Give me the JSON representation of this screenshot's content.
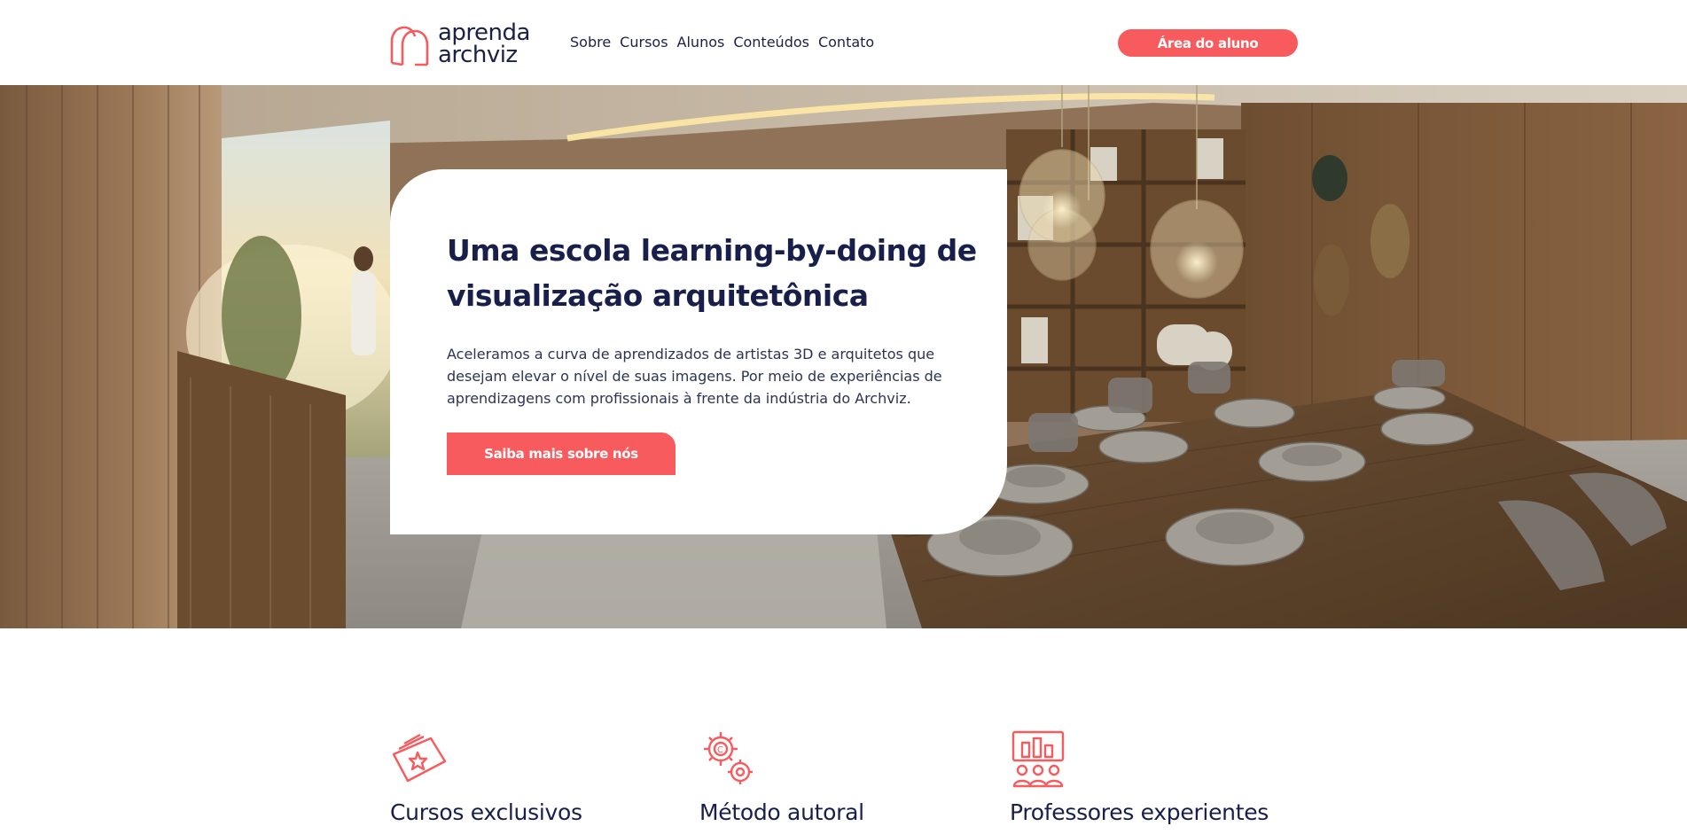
{
  "header": {
    "logo": {
      "line1": "aprenda",
      "line2": "archviz",
      "icon": "logo-arch-icon"
    },
    "nav": [
      {
        "label": "Sobre"
      },
      {
        "label": "Cursos"
      },
      {
        "label": "Alunos"
      },
      {
        "label": "Conteúdos"
      },
      {
        "label": "Contato"
      }
    ],
    "cta_label": "Área do aluno"
  },
  "hero": {
    "title": "Uma escola learning-by-doing de visualização arquitetônica",
    "description": "Aceleramos a curva de aprendizados de artistas 3D e arquitetos que desejam elevar o nível de suas imagens. Por meio de experiências de aprendizagens com profissionais à frente da indústria do Archviz.",
    "button_label": "Saiba mais sobre nós",
    "image": "dining-room-render"
  },
  "features": [
    {
      "title": "Cursos exclusivos",
      "icon": "tickets-icon"
    },
    {
      "title": "Método autoral",
      "icon": "gears-icon"
    },
    {
      "title": "Professores experientes",
      "icon": "presentation-icon"
    }
  ],
  "colors": {
    "accent": "#f75b5e",
    "navy": "#171f4a",
    "text": "#2c3353",
    "background": "#ffffff"
  }
}
